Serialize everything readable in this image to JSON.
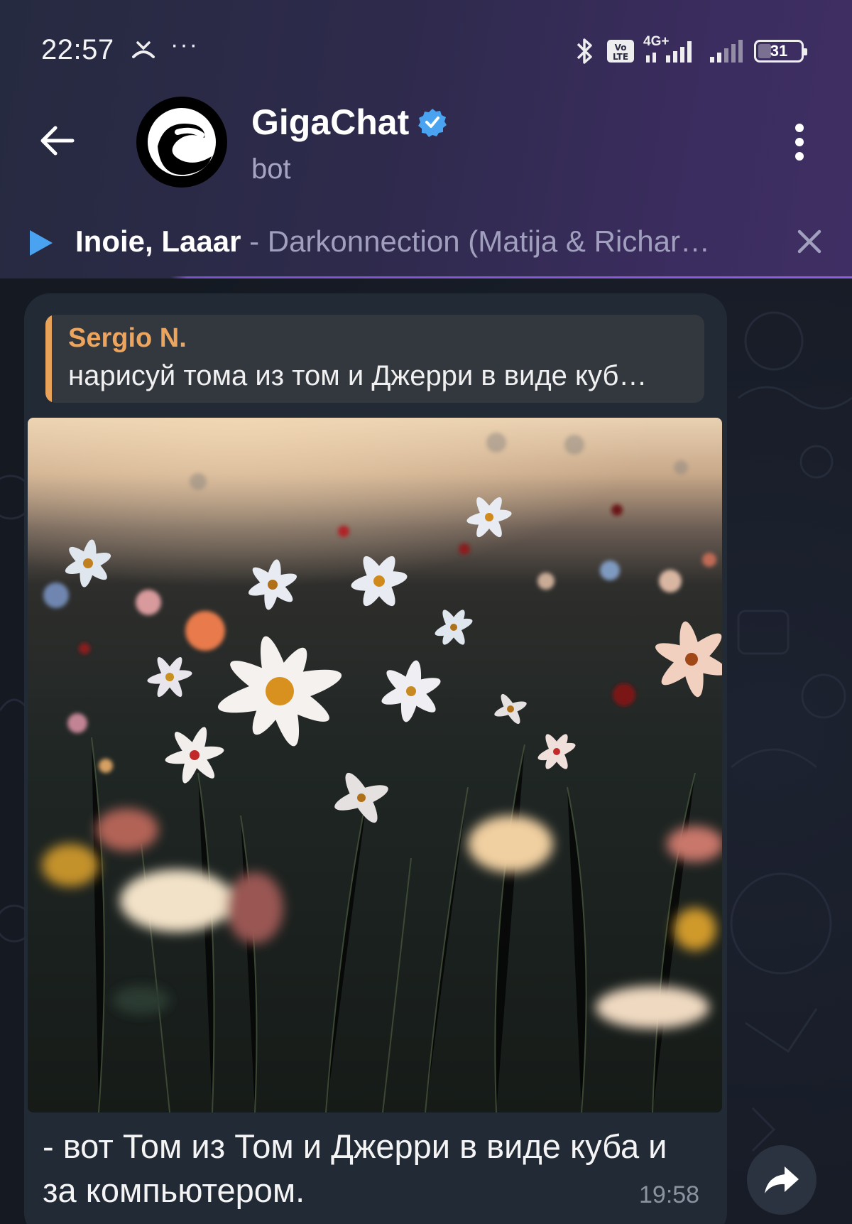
{
  "status_bar": {
    "time": "22:57",
    "dots": "···",
    "network": "4G+",
    "volte": "Vo LTE",
    "battery": "31",
    "icons": [
      "missed-call-icon",
      "bluetooth-icon",
      "volte-icon",
      "signal-icon",
      "signal-icon",
      "battery-icon"
    ]
  },
  "chat_header": {
    "title": "GigaChat",
    "subtitle": "bot",
    "verified": true,
    "icons": [
      "back-arrow-icon",
      "verified-icon",
      "more-vertical-icon"
    ]
  },
  "player": {
    "artist": "Inoie, Laaar",
    "title": " - Darkonnection (Matija & Richar…",
    "icons": [
      "play-icon",
      "close-icon"
    ]
  },
  "message": {
    "reply": {
      "name": "Sergio N.",
      "text": "нарисуй тома из том и Джерри в виде куб…"
    },
    "caption": "- вот Том из Том и Джерри в виде куба и за компьютером.",
    "time": "19:58",
    "photo_description_icon": "photo"
  },
  "colors": {
    "accent_blue": "#4aa3f0",
    "reply_accent": "#e9a25a",
    "bubble": "#222a36",
    "header_purple": "#3b2d5f"
  }
}
